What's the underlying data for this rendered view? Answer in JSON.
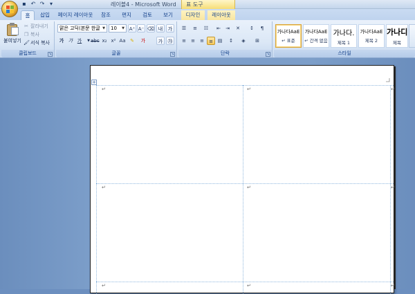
{
  "window": {
    "title": "레이블4 - Microsoft Word",
    "context_title": "표 도구"
  },
  "quick_access": {
    "save_icon": "save-icon",
    "undo_icon": "undo-icon",
    "redo_icon": "redo-icon"
  },
  "tabs": [
    {
      "label": "홈",
      "active": true
    },
    {
      "label": "삽입"
    },
    {
      "label": "페이지 레이아웃"
    },
    {
      "label": "참조"
    },
    {
      "label": "편지"
    },
    {
      "label": "검토"
    },
    {
      "label": "보기"
    },
    {
      "label": "디자인",
      "contextual": true
    },
    {
      "label": "레이아웃",
      "contextual": true
    }
  ],
  "ribbon": {
    "clipboard": {
      "label": "클립보드",
      "paste": "붙여넣기",
      "cut": "잘라내기",
      "copy": "복사",
      "format_painter": "서식 복사"
    },
    "font": {
      "label": "글꼴",
      "font_name": "맑은 고딕(본문 한글",
      "font_size": "10"
    },
    "paragraph": {
      "label": "단락"
    },
    "styles": {
      "label": "스타일",
      "items": [
        {
          "sample": "가나다AaE",
          "name": "↵ 표준",
          "selected": true
        },
        {
          "sample": "가나다AaE",
          "name": "↵ 간격 없음"
        },
        {
          "sample": "가나다.",
          "name": "제목 1"
        },
        {
          "sample": "가나다AaE",
          "name": "제목 2"
        },
        {
          "sample": "가나디",
          "name": "제목"
        }
      ]
    }
  },
  "document": {
    "paragraph_mark": "↵",
    "table_move_handle": "+"
  },
  "colors": {
    "ribbon_accent": "#15428b",
    "office_button": "#f4c64a",
    "context_tab": "#f6dd77",
    "doc_background": "#7c9ec9",
    "table_gridline": "#8fb7de"
  }
}
